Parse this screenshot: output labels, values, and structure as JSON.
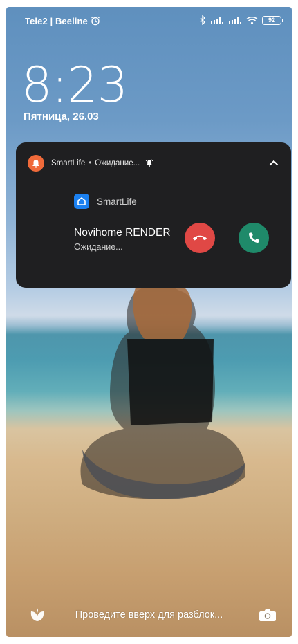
{
  "status_bar": {
    "carrier": "Tele2 | Beeline",
    "battery": "92",
    "icons": [
      "alarm-icon",
      "bluetooth-icon",
      "signal-icon",
      "signal-icon",
      "wifi-icon",
      "battery-icon"
    ]
  },
  "lockscreen": {
    "time": "8:23",
    "date": "Пятница, 26.03"
  },
  "notification": {
    "app_name": "SmartLife",
    "separator": "•",
    "summary": "Ожидание...",
    "app_label": "SmartLife",
    "title": "Novihome RENDER",
    "subtitle": "Ожидание...",
    "colors": {
      "app_dot": "#f06a3a",
      "decline": "#e04845",
      "accept": "#1f8a6a",
      "card": "#1f1f21"
    }
  },
  "bottom": {
    "swipe_hint": "Проведите вверх для разблок..."
  }
}
